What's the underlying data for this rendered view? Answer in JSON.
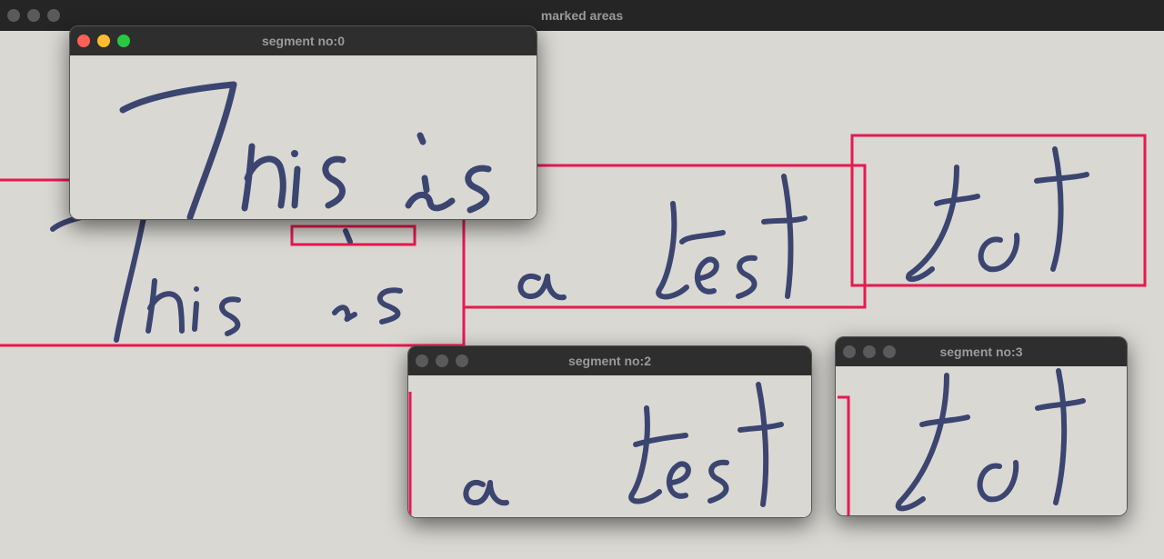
{
  "main_window": {
    "title": "marked areas",
    "traffic_lights": [
      "close-button",
      "minimize-button",
      "zoom-button"
    ]
  },
  "segments": [
    {
      "title": "segment no:0",
      "words": "This is",
      "active": true
    },
    {
      "title": "segment no:2",
      "words": "a test",
      "active": false
    },
    {
      "title": "segment no:3",
      "words": "text",
      "active": false
    }
  ],
  "colors": {
    "marker": "#e8194f",
    "ink": "#3b4570",
    "paper": "#d9d8d3",
    "titlebar": "#2e2e2e"
  }
}
